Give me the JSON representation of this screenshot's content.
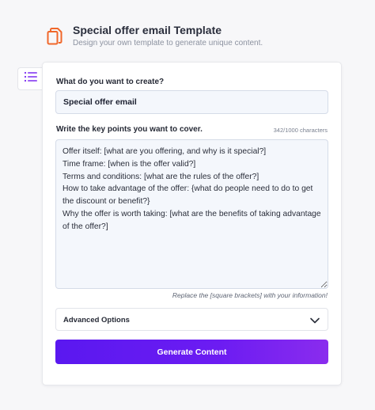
{
  "header": {
    "title": "Special offer email Template",
    "subtitle": "Design your own template to generate unique content.",
    "icon": "copy-document-icon",
    "icon_color": "#f0672a"
  },
  "sidebar_toggle": {
    "icon": "list-icon",
    "icon_color": "#7b2cf0"
  },
  "form": {
    "create_label": "What do you want to create?",
    "create_value": "Special offer email",
    "points_label": "Write the key points you want to cover.",
    "char_count": "342/1000 characters",
    "points_value": "Offer itself: [what are you offering, and why is it special?]\nTime frame: [when is the offer valid?]\nTerms and conditions: [what are the rules of the offer?]\nHow to take advantage of the offer: {what do people need to do to get the discount or benefit?}\nWhy the offer is worth taking: [what are the benefits of taking advantage of the offer?]",
    "hint": "Replace the [square brackets] with your information!",
    "advanced_label": "Advanced Options",
    "generate_label": "Generate Content"
  },
  "colors": {
    "accent": "#6a1cf2",
    "field_bg": "#f4f7fc",
    "page_bg": "#f7f7f9"
  }
}
